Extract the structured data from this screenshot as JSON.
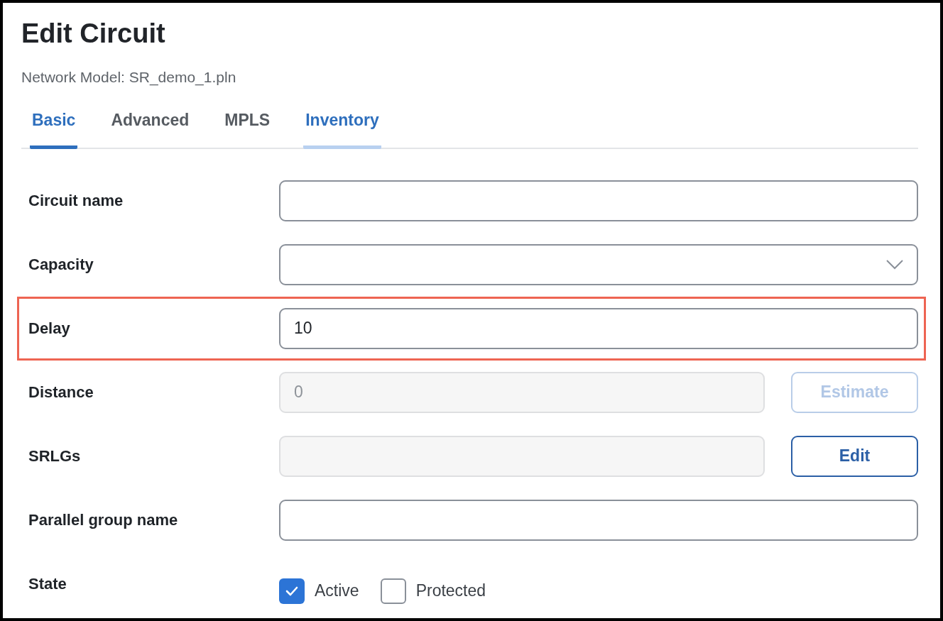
{
  "title": "Edit Circuit",
  "subtitle": "Network Model: SR_demo_1.pln",
  "tabs": [
    {
      "label": "Basic",
      "selected": true,
      "hovered": false
    },
    {
      "label": "Advanced",
      "selected": false,
      "hovered": false
    },
    {
      "label": "MPLS",
      "selected": false,
      "hovered": false
    },
    {
      "label": "Inventory",
      "selected": false,
      "hovered": true
    }
  ],
  "fields": [
    {
      "label": "Circuit name",
      "kind": "text",
      "disabled": false,
      "highlighted": false
    },
    {
      "label": "Capacity",
      "kind": "select",
      "disabled": false,
      "highlighted": false
    },
    {
      "label": "Delay",
      "kind": "text",
      "value": "10",
      "disabled": false,
      "highlighted": true
    },
    {
      "label": "Distance",
      "kind": "text",
      "value": "0",
      "disabled": true,
      "highlighted": false,
      "button": {
        "label": "Estimate",
        "disabled": true
      }
    },
    {
      "label": "SRLGs",
      "kind": "text",
      "disabled": true,
      "highlighted": false,
      "button": {
        "label": "Edit",
        "disabled": false
      }
    },
    {
      "label": "Parallel group name",
      "kind": "text",
      "disabled": false,
      "highlighted": false
    },
    {
      "label": "State",
      "kind": "checkboxes",
      "highlighted": false,
      "options": [
        {
          "label": "Active",
          "checked": true
        },
        {
          "label": "Protected",
          "checked": false
        }
      ]
    }
  ]
}
